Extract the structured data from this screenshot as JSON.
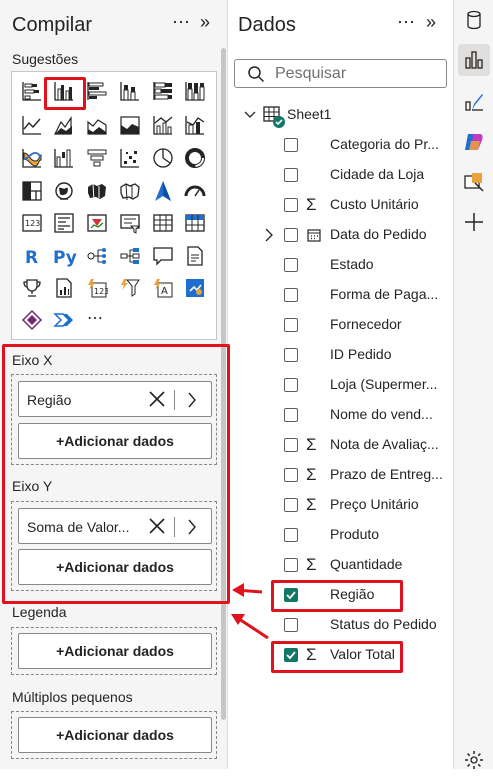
{
  "build_pane": {
    "title": "Compilar",
    "more_label": "⋯",
    "collapse_label": "»",
    "suggestions_label": "Sugestões",
    "more_visuals_label": "⋯",
    "x_axis": {
      "label": "Eixo X",
      "field": "Região",
      "add_label": "+Adicionar dados"
    },
    "y_axis": {
      "label": "Eixo Y",
      "field": "Soma de Valor...",
      "add_label": "+Adicionar dados"
    },
    "legend": {
      "label": "Legenda",
      "add_label": "+Adicionar dados"
    },
    "small_multiples": {
      "label": "Múltiplos pequenos",
      "add_label": "+Adicionar dados"
    }
  },
  "data_pane": {
    "title": "Dados",
    "more_label": "⋯",
    "collapse_label": "»",
    "search_placeholder": "Pesquisar",
    "table_name": "Sheet1",
    "fields": [
      {
        "name": "Categoria do Pr...",
        "sigma": false,
        "checked": false,
        "expandable": false,
        "date": false
      },
      {
        "name": "Cidade da Loja",
        "sigma": false,
        "checked": false,
        "expandable": false,
        "date": false
      },
      {
        "name": "Custo Unitário",
        "sigma": true,
        "checked": false,
        "expandable": false,
        "date": false
      },
      {
        "name": "Data do Pedido",
        "sigma": false,
        "checked": false,
        "expandable": true,
        "date": true
      },
      {
        "name": "Estado",
        "sigma": false,
        "checked": false,
        "expandable": false,
        "date": false
      },
      {
        "name": "Forma de Paga...",
        "sigma": false,
        "checked": false,
        "expandable": false,
        "date": false
      },
      {
        "name": "Fornecedor",
        "sigma": false,
        "checked": false,
        "expandable": false,
        "date": false
      },
      {
        "name": "ID Pedido",
        "sigma": false,
        "checked": false,
        "expandable": false,
        "date": false
      },
      {
        "name": "Loja (Supermer...",
        "sigma": false,
        "checked": false,
        "expandable": false,
        "date": false
      },
      {
        "name": "Nome do vend...",
        "sigma": false,
        "checked": false,
        "expandable": false,
        "date": false
      },
      {
        "name": "Nota de Avaliaç...",
        "sigma": true,
        "checked": false,
        "expandable": false,
        "date": false
      },
      {
        "name": "Prazo de Entreg...",
        "sigma": true,
        "checked": false,
        "expandable": false,
        "date": false
      },
      {
        "name": "Preço Unitário",
        "sigma": true,
        "checked": false,
        "expandable": false,
        "date": false
      },
      {
        "name": "Produto",
        "sigma": false,
        "checked": false,
        "expandable": false,
        "date": false
      },
      {
        "name": "Quantidade",
        "sigma": true,
        "checked": false,
        "expandable": false,
        "date": false
      },
      {
        "name": "Região",
        "sigma": false,
        "checked": true,
        "expandable": false,
        "date": false
      },
      {
        "name": "Status do Pedido",
        "sigma": false,
        "checked": false,
        "expandable": false,
        "date": false
      },
      {
        "name": "Valor Total",
        "sigma": true,
        "checked": true,
        "expandable": false,
        "date": false
      }
    ]
  },
  "colors": {
    "accent_teal": "#117865",
    "annotation_red": "#e0121d",
    "pane_bg": "#f5f5f5"
  },
  "visual_icons": [
    "stacked-bar-chart-icon",
    "clustered-column-chart-icon",
    "clustered-bar-chart-icon",
    "stacked-column-chart-icon",
    "100-stacked-bar-chart-icon",
    "100-stacked-column-chart-icon",
    "line-chart-icon",
    "area-chart-icon",
    "stacked-area-chart-icon",
    "100-stacked-area-chart-icon",
    "line-clustered-column-chart-icon",
    "line-stacked-column-chart-icon",
    "ribbon-chart-icon",
    "waterfall-chart-icon",
    "funnel-chart-icon",
    "scatter-chart-icon",
    "pie-chart-icon",
    "donut-chart-icon",
    "treemap-icon",
    "map-icon",
    "filled-map-icon",
    "shape-map-icon",
    "azure-map-icon",
    "gauge-icon",
    "card-icon",
    "multi-row-card-icon",
    "kpi-icon",
    "slicer-icon",
    "table-icon",
    "matrix-icon",
    "r-script-visual-icon",
    "python-visual-icon",
    "key-influencers-icon",
    "decomposition-tree-icon",
    "qa-visual-icon",
    "paginated-report-icon",
    "trophy-icon",
    "report-icon",
    "power-apps-icon",
    "power-automate-icon",
    "smart-narrative-icon",
    "custom-visual-icon",
    "power-apps-alt-icon",
    "chevron-visual-icon"
  ]
}
